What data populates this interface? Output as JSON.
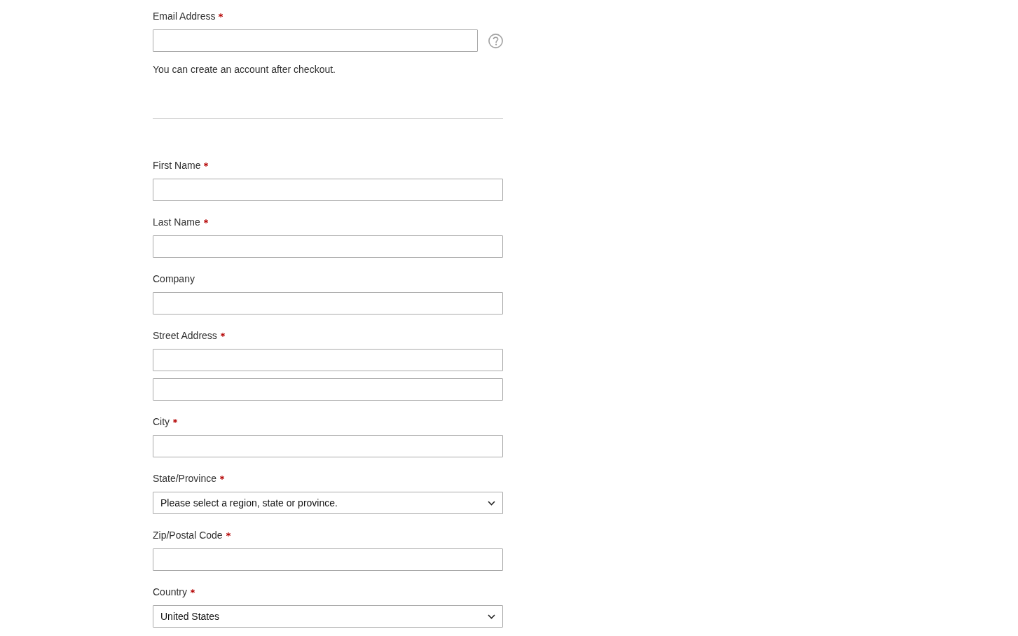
{
  "email": {
    "label": "Email Address",
    "required": true,
    "note": "You can create an account after checkout."
  },
  "fields": [
    {
      "kind": "text",
      "label": "First Name",
      "required": true
    },
    {
      "kind": "text",
      "label": "Last Name",
      "required": true
    },
    {
      "kind": "text",
      "label": "Company",
      "required": false
    },
    {
      "kind": "address_lines",
      "label": "Street Address",
      "required": true
    },
    {
      "kind": "text",
      "label": "City",
      "required": true
    },
    {
      "kind": "select",
      "label": "State/Province",
      "required": true,
      "value": "Please select a region, state or province."
    },
    {
      "kind": "text",
      "label": "Zip/Postal Code",
      "required": true
    },
    {
      "kind": "select",
      "label": "Country",
      "required": true,
      "value": "United States"
    }
  ]
}
